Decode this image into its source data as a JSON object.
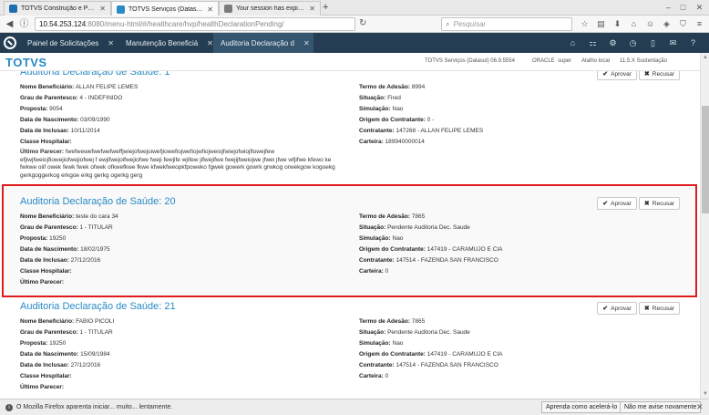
{
  "browser": {
    "tabs": [
      {
        "title": "TOTVS Construção e Proje...",
        "favicon_color": "#1f6db1"
      },
      {
        "title": "TOTVS Serviços (Datasul) ...",
        "favicon_color": "#2a8ac4"
      },
      {
        "title": "Your session has expired.",
        "favicon_color": "#7a7a7a"
      }
    ],
    "url_host": "10.54.253.124",
    "url_path": ":8080/menu-html/#/healthcare/hvp/healthDeclarationPending/",
    "search_placeholder": "Pesquisar"
  },
  "app": {
    "tabs": [
      {
        "label": "Painel de Solicitações"
      },
      {
        "label": "Manutenção Beneficiá"
      },
      {
        "label": "Auditoria Declaração d"
      }
    ],
    "brand": "TOTVS",
    "sysinfo": {
      "company": "TOTVS Serviços (Datasul) 06.9.5554",
      "db": "ORACLE",
      "user": "super",
      "env": "Atalho local",
      "version": "11.5.X Sustentação"
    }
  },
  "labels": {
    "nome": "Nome Beneficiário:",
    "grau": "Grau de Parentesco:",
    "proposta": "Proposta:",
    "nascimento": "Data de Nascimento:",
    "inclusao": "Data de Inclusao:",
    "classe": "Classe Hospitalar:",
    "parecer": "Último Parecer:",
    "termo": "Termo de Adesão:",
    "situacao": "Situação:",
    "simulacao": "Simulação:",
    "origem": "Origem do Contratante:",
    "contratante": "Contratante:",
    "carteira": "Carteira:"
  },
  "actions": {
    "aprovar": "Aprovar",
    "recusar": "Recusar"
  },
  "cards": [
    {
      "title": "Auditoria Declaração de Saúde: 1",
      "nome": "ALLAN FELIPE LEMES",
      "grau": "4 - INDEFINIDO",
      "proposta": "9054",
      "nascimento": "03/09/1990",
      "inclusao": "10/11/2014",
      "classe": "",
      "parecer": "fwefwewefwefwefweffjwiejofwejoiwefjiowefiojwefiojwfiojweiojfwiejofwiojflowejfew efjiwjfweiojfiowejiofwejiofwej f ewjifwejoifwejiofwe fweji fewjife wjifew jifwejifwe fwejijfweiojwe jfwei jfwe wfjifwe kfewo ke fwkwe oiif owek fewk fwek ofwek ofkwefkwe fkwe kfwekfweopkfpoweko fgwek gowerk gowrk grwkog orwekgow kogoekg gerkgoggerkog erkgoe erkg gerkg ogerkg gerg",
      "termo": "8994",
      "situacao": "Fired",
      "simulacao": "Nao",
      "origem": "0 -",
      "contratante": "147268 - ALLAN FELIPE LEMES",
      "carteira": "189940000014"
    },
    {
      "title": "Auditoria Declaração de Saúde: 20",
      "nome": "teste do cara 34",
      "grau": "1 - TITULAR",
      "proposta": "19250",
      "nascimento": "18/02/1975",
      "inclusao": "27/12/2016",
      "classe": "",
      "parecer": "",
      "termo": "7865",
      "situacao": "Pendente Auditoria Dec. Saude",
      "simulacao": "Nao",
      "origem": "147419 - CARAMUJO E CIA",
      "contratante": "147514 - FAZENDA SAN FRANCISCO",
      "carteira": "0"
    },
    {
      "title": "Auditoria Declaração de Saúde: 21",
      "nome": "FABIO PICOLI",
      "grau": "1 - TITULAR",
      "proposta": "19250",
      "nascimento": "15/09/1984",
      "inclusao": "27/12/2016",
      "classe": "",
      "parecer": "",
      "termo": "7865",
      "situacao": "Pendente Auditoria Dec. Saude",
      "simulacao": "Nao",
      "origem": "147419 - CARAMUJO E CIA",
      "contratante": "147514 - FAZENDA SAN FRANCISCO",
      "carteira": "0"
    }
  ],
  "notification": {
    "message": "O Mozilla Firefox aparenta iniciar... muito... lentamente.",
    "learn": "Aprenda como acelerá-lo",
    "dismiss": "Não me avise novamente"
  },
  "colors": {
    "accent": "#2a8ac4",
    "header": "#243d52",
    "highlight": "#e01b1b"
  }
}
